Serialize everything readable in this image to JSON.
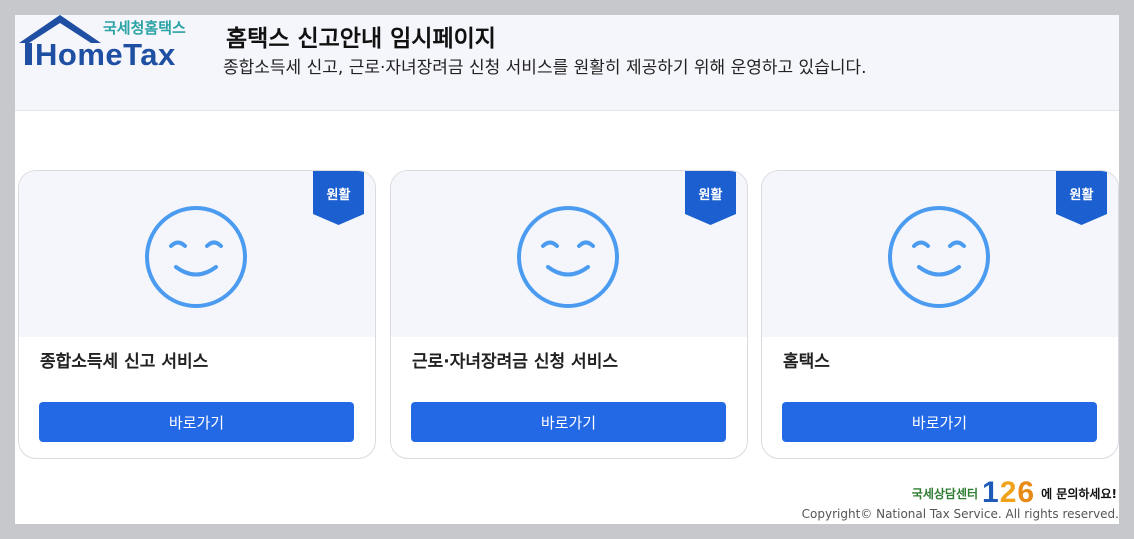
{
  "header": {
    "logo_sub": "국세청홈택스",
    "logo_main": "HomeTax",
    "title": "홈택스 신고안내 임시페이지",
    "subtitle": "종합소득세 신고, 근로·자녀장려금 신청 서비스를 원활히 제공하기 위해 운영하고 있습니다."
  },
  "cards": [
    {
      "badge": "원활",
      "title": "종합소득세 신고 서비스",
      "button": "바로가기"
    },
    {
      "badge": "원활",
      "title": "근로·자녀장려금 신청 서비스",
      "button": "바로가기"
    },
    {
      "badge": "원활",
      "title": "홈택스",
      "button": "바로가기"
    }
  ],
  "footer": {
    "help_prefix": "국세상담센터",
    "help_number": "126",
    "help_suffix": "에 문의하세요!",
    "copyright": "Copyright© National Tax Service. All rights reserved."
  },
  "colors": {
    "accent": "#2369e6",
    "badge": "#1b5fd1",
    "smile": "#4b9cf0"
  },
  "icons": [
    "house-roof-logo-icon",
    "smiley-icon",
    "status-badge-icon"
  ]
}
